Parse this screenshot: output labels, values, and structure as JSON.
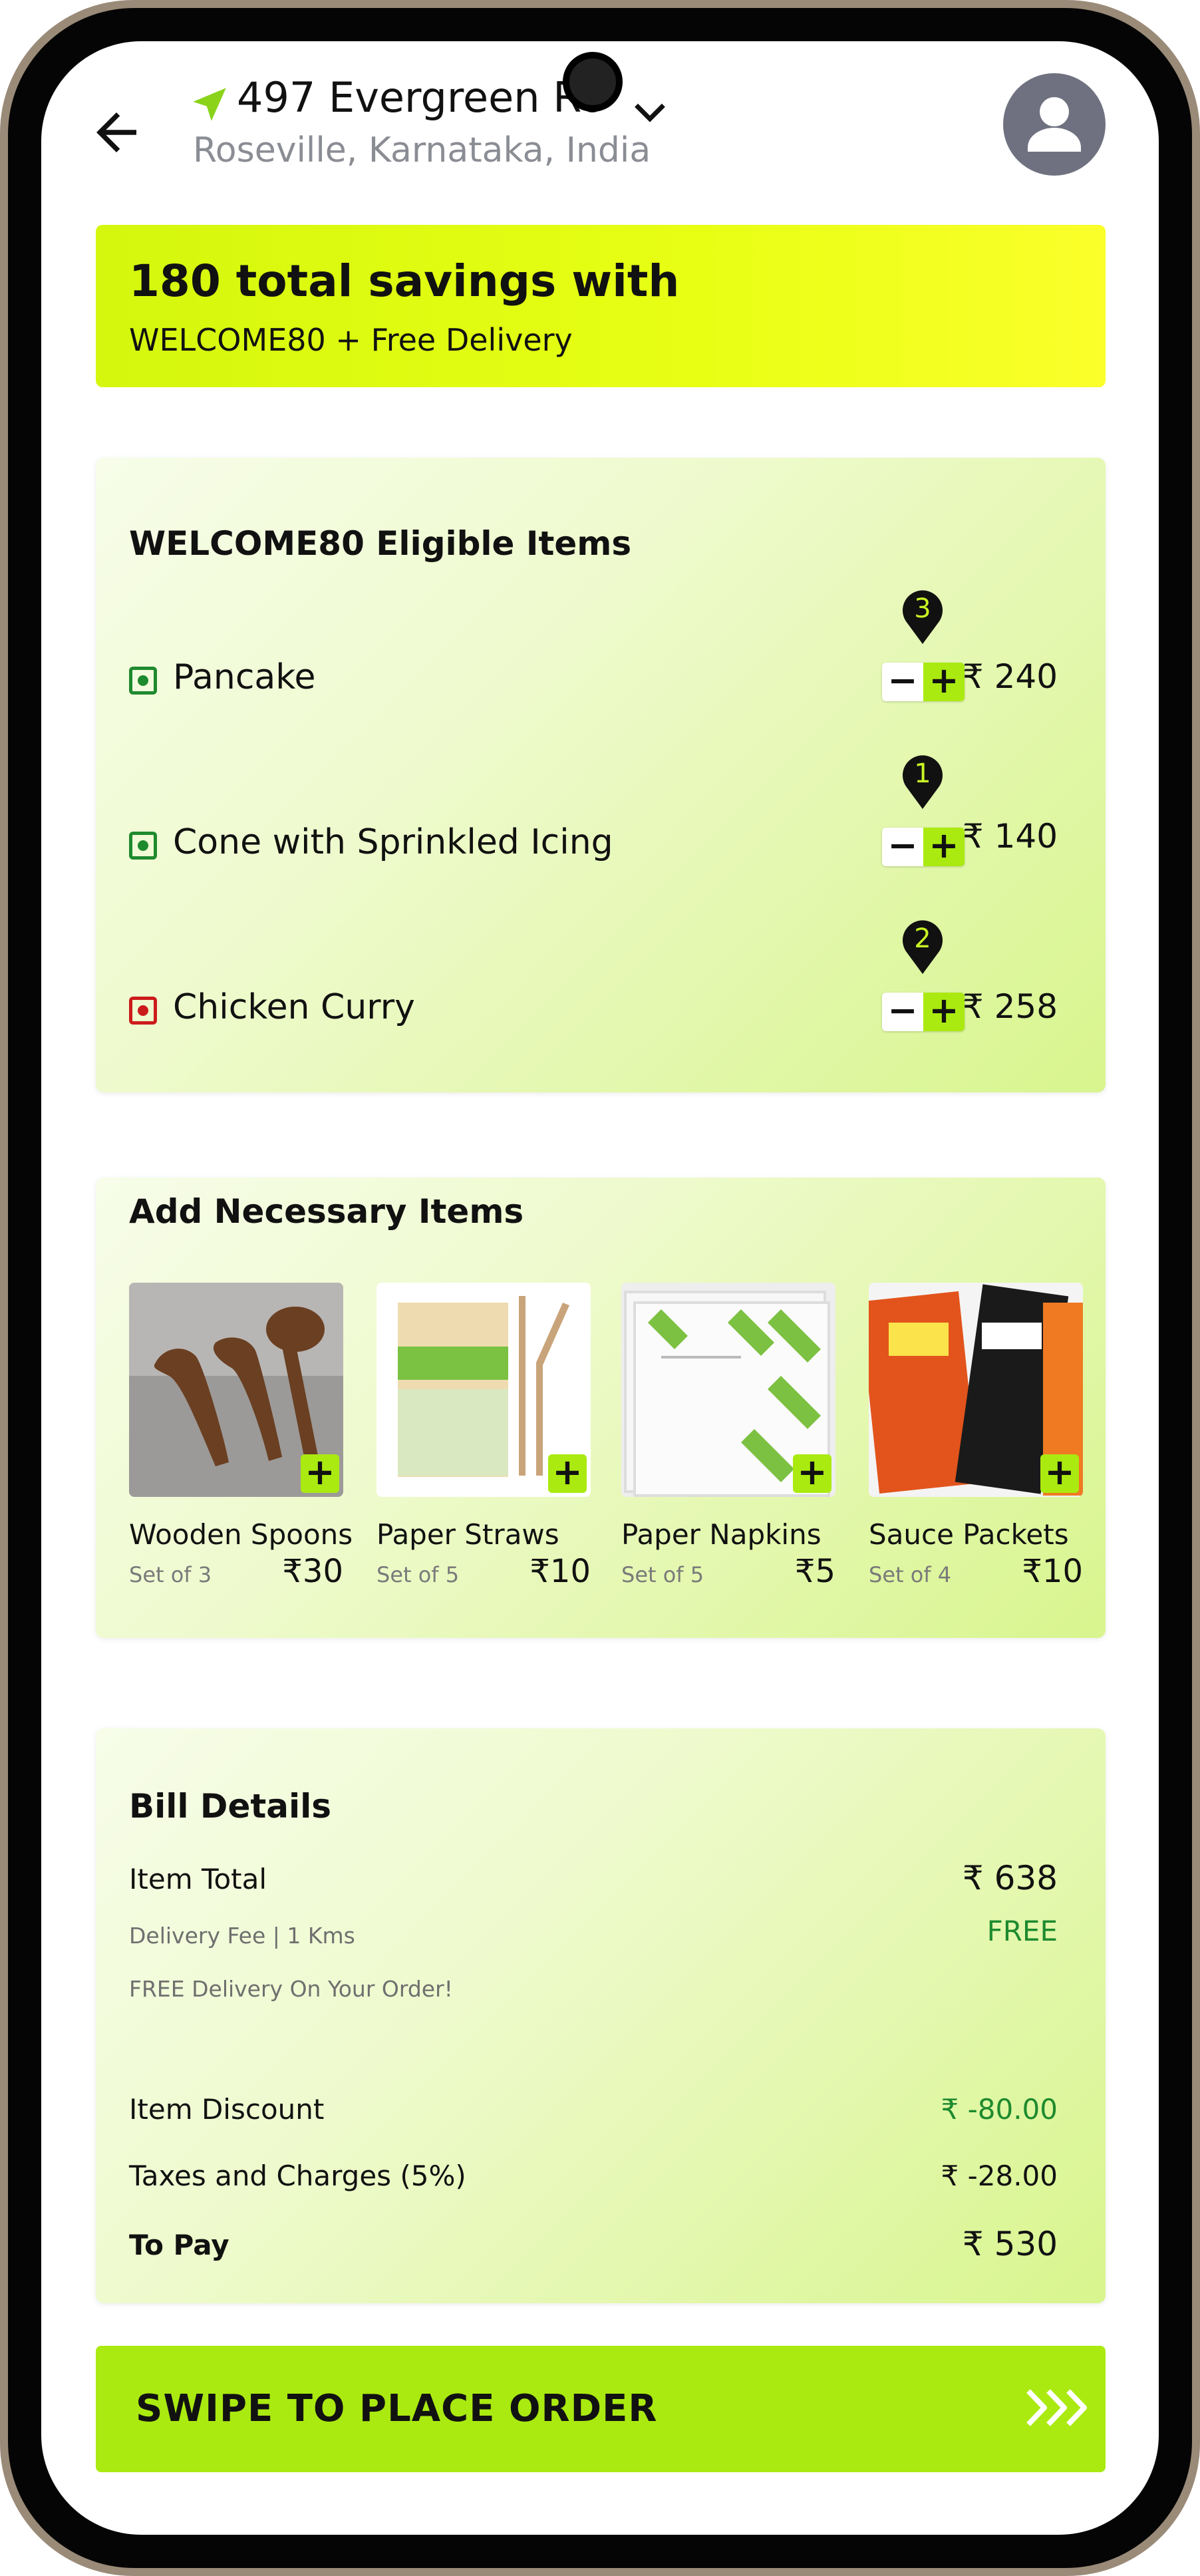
{
  "header": {
    "address_line": "497 Evergreen Ro",
    "address_sub": "Roseville, Karnataka, India"
  },
  "savings": {
    "title": "180 total savings with",
    "subtitle": "WELCOME80 + Free Delivery"
  },
  "eligible": {
    "title": "WELCOME80 Eligible Items",
    "items": [
      {
        "name": "Pancake",
        "qty": "3",
        "price": "₹ 240",
        "veg": true
      },
      {
        "name": "Cone with Sprinkled Icing",
        "qty": "1",
        "price": "₹ 140",
        "veg": true
      },
      {
        "name": "Chicken Curry",
        "qty": "2",
        "price": "₹ 258",
        "veg": false
      }
    ],
    "minus": "−",
    "plus": "+"
  },
  "necessary": {
    "title": "Add Necessary Items",
    "items": [
      {
        "name": "Wooden Spoons",
        "set": "Set of 3",
        "price": "₹30"
      },
      {
        "name": "Paper Straws",
        "set": "Set of 5",
        "price": "₹10"
      },
      {
        "name": "Paper Napkins",
        "set": "Set of 5",
        "price": "₹5"
      },
      {
        "name": "Sauce Packets",
        "set": "Set of 4",
        "price": "₹10"
      }
    ],
    "add": "+"
  },
  "bill": {
    "title": "Bill Details",
    "item_total_label": "Item Total",
    "item_total_value": "₹ 638",
    "delivery_label": "Delivery Fee | 1 Kms",
    "delivery_value": "FREE",
    "free_note": "FREE Delivery On Your Order!",
    "discount_label": "Item Discount",
    "discount_value": "₹ -80.00",
    "taxes_label": "Taxes and Charges (5%)",
    "taxes_value": "₹ -28.00",
    "topay_label": "To Pay",
    "topay_value": "₹ 530"
  },
  "swipe": {
    "label": "SWIPE TO PLACE ORDER"
  },
  "colors": {
    "accent": "#aaea10",
    "veg": "#1e8a2e",
    "nonveg": "#cc1b1b",
    "discount": "#1e8a2e"
  },
  "icons": [
    "back-arrow-icon",
    "location-pin-icon",
    "chevron-down-icon",
    "avatar-icon",
    "chevrons-right-icon"
  ]
}
